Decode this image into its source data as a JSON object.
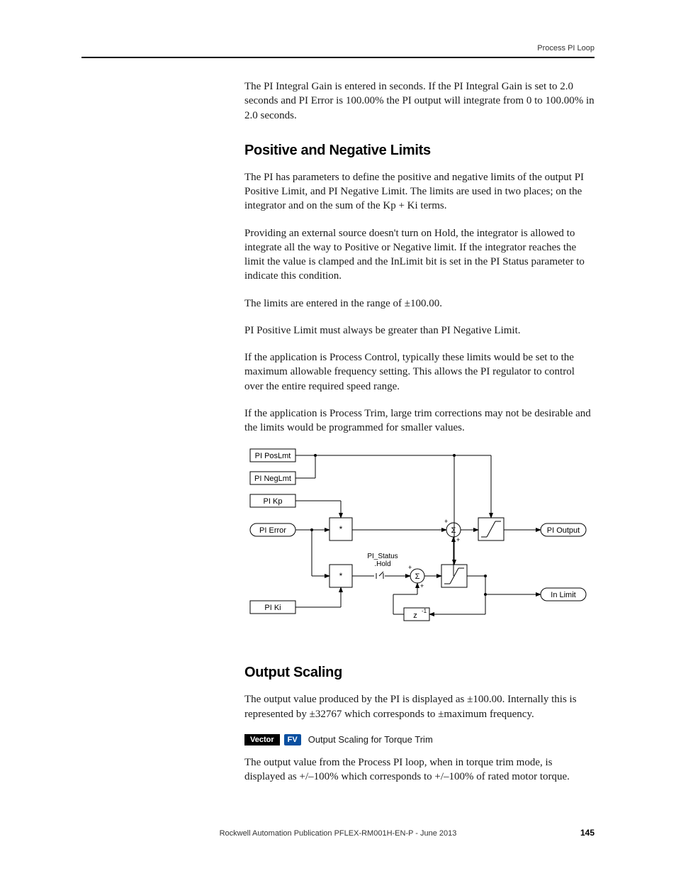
{
  "header": {
    "running_head": "Process PI Loop"
  },
  "paragraphs": {
    "intro": "The PI Integral Gain is entered in seconds. If the PI Integral Gain is set to 2.0 seconds and PI Error is 100.00% the PI output will integrate from 0 to 100.00% in 2.0 seconds.",
    "limits_heading": "Positive and Negative Limits",
    "limits_p1": "The PI has parameters to define the positive and negative limits of the output PI Positive Limit, and PI Negative Limit. The limits are used in two places; on the integrator and on the sum of the Kp + Ki terms.",
    "limits_p2": "Providing an external source doesn't turn on Hold, the integrator is allowed to integrate all the way to Positive or Negative limit. If the integrator reaches the limit the value is clamped and the InLimit bit is set in the PI Status parameter to indicate this condition.",
    "limits_p3": "The limits are entered in the range of ±100.00.",
    "limits_p4": "PI Positive Limit must always be greater than PI Negative Limit.",
    "limits_p5": "If the application is Process Control, typically these limits would be set to the maximum allowable frequency setting. This allows the PI regulator to control over the entire required speed range.",
    "limits_p6": "If the application is Process Trim, large trim corrections may not be desirable and the limits would be programmed for smaller values.",
    "scaling_heading": "Output Scaling",
    "scaling_p1": "The output value produced by the PI is displayed as ±100.00. Internally this is represented by ±32767 which corresponds to ±maximum frequency.",
    "scaling_badge_label": "Output Scaling for Torque Trim",
    "scaling_p2": "The output value from the Process PI loop, when in torque trim mode, is displayed as +/–100% which corresponds to +/–100% of rated motor torque."
  },
  "diagram": {
    "pi_poslmt": "PI PosLmt",
    "pi_neglmt": "PI NegLmt",
    "pi_kp": "PI Kp",
    "pi_error": "PI Error",
    "pi_ki": "PI Ki",
    "pi_output": "PI Output",
    "in_limit": "In Limit",
    "pi_status": "PI_Status",
    "hold": ".Hold",
    "z_delay": "z",
    "z_delay_sup": "-1",
    "plus": "+",
    "star": "*"
  },
  "badges": {
    "vector": "Vector",
    "fv": "FV"
  },
  "footer": {
    "publication": "Rockwell Automation Publication PFLEX-RM001H-EN-P - June 2013",
    "page": "145"
  }
}
